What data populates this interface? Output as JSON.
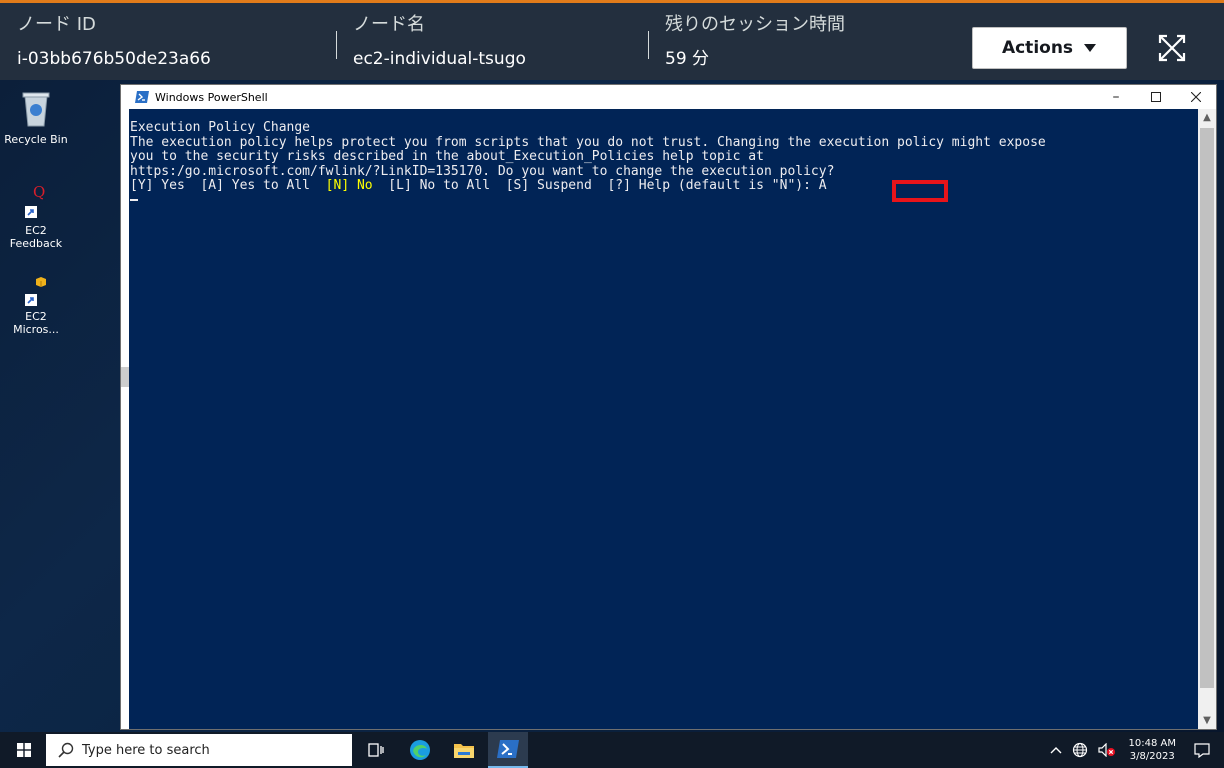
{
  "session": {
    "node_id_label": "ノード ID",
    "node_id_value": "i-03bb676b50de23a66",
    "node_name_label": "ノード名",
    "node_name_value": "ec2-individual-tsugo",
    "remaining_label": "残りのセッション時間",
    "remaining_value": "59 分",
    "actions_label": "Actions"
  },
  "desktop": {
    "icons": [
      {
        "label": "Recycle Bin"
      },
      {
        "label": "EC2\nFeedback"
      },
      {
        "label": "EC2\nMicros..."
      }
    ]
  },
  "powershell": {
    "title": "Windows PowerShell",
    "line1": "Execution Policy Change",
    "line2": "The execution policy helps protect you from scripts that you do not trust. Changing the execution policy might expose",
    "line3": "you to the security risks described in the about_Execution_Policies help topic at",
    "line4": "https:/go.microsoft.com/fwlink/?LinkID=135170. Do you want to change the execution policy?",
    "opt_a": "[Y] Yes  [A] Yes to All  ",
    "opt_default": "[N] No",
    "opt_b": "  [L] No to All  [S] Suspend  [?] Help (default is \"N\"): ",
    "answer": "A"
  },
  "taskbar": {
    "search_placeholder": "Type here to search",
    "time": "10:48 AM",
    "date": "3/8/2023"
  },
  "colors": {
    "console_bg": "#012456",
    "header_bg": "#232f3e",
    "accent": "#e07b1a",
    "highlight": "#e8141a"
  }
}
